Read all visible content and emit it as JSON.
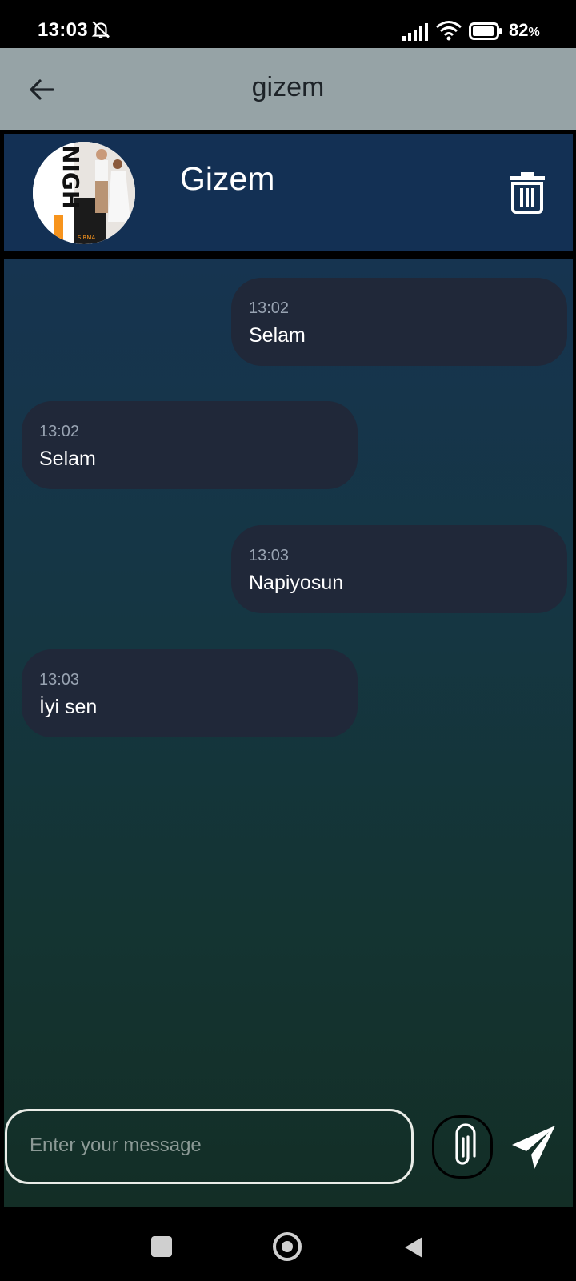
{
  "status_bar": {
    "time": "13:03",
    "battery": "82",
    "battery_unit": "%",
    "icons": [
      "bell-off-icon",
      "signal-icon",
      "wifi-icon",
      "battery-icon"
    ]
  },
  "app_bar": {
    "title": "gizem",
    "back_icon": "arrow-left-icon"
  },
  "contact": {
    "name": "Gizem",
    "avatar_text": "NIGH",
    "avatar_caption": "SIRMA",
    "delete_icon": "trash-icon"
  },
  "messages": [
    {
      "time": "13:02",
      "text": "Selam",
      "side": "right"
    },
    {
      "time": "13:02",
      "text": "Selam",
      "side": "left"
    },
    {
      "time": "13:03",
      "text": "Napiyosun",
      "side": "right"
    },
    {
      "time": "13:03",
      "text": "İyi sen",
      "side": "left"
    }
  ],
  "composer": {
    "placeholder": "Enter your message",
    "attach_icon": "paperclip-icon",
    "send_icon": "send-icon"
  },
  "nav_bar": {
    "icons": [
      "recents-icon",
      "home-icon",
      "back-icon"
    ]
  },
  "colors": {
    "app_bar": "#96a3a6",
    "header": "#133054",
    "bubble": "#202839",
    "accent_orange": "#f7941d"
  }
}
